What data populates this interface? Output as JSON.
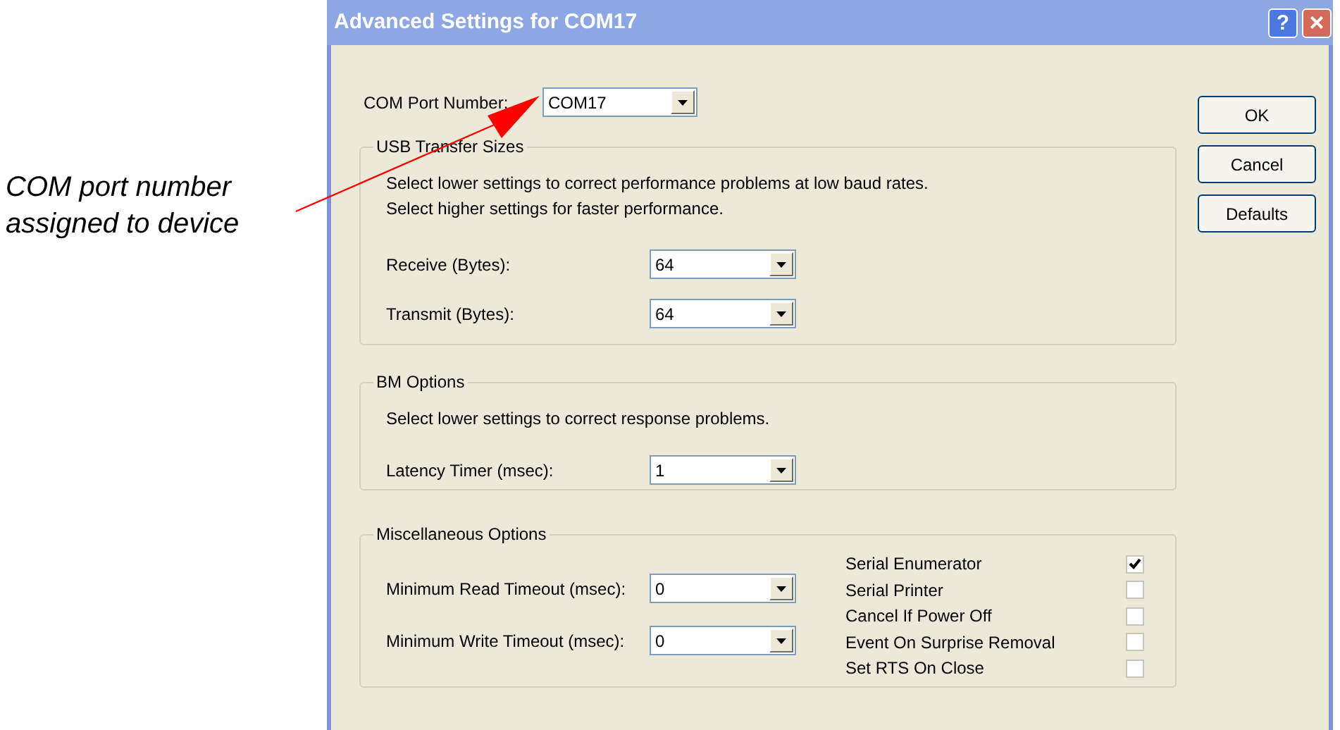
{
  "annotation": {
    "text": "COM port number assigned to device"
  },
  "window": {
    "title": "Advanced Settings for COM17",
    "help": "?",
    "close": "×"
  },
  "com_port": {
    "label": "COM Port Number:",
    "value": "COM17"
  },
  "usb_transfer_sizes": {
    "title": "USB Transfer Sizes",
    "notes": [
      "Select lower settings to correct performance problems at low baud rates.",
      "Select higher settings for faster performance."
    ],
    "fields": [
      {
        "label": "Receive (Bytes):",
        "value": "64"
      },
      {
        "label": "Transmit (Bytes):",
        "value": "64"
      }
    ]
  },
  "bm_options": {
    "title": "BM Options",
    "note": "Select lower settings to correct response problems.",
    "fields": [
      {
        "label": "Latency Timer (msec):",
        "value": "1"
      }
    ]
  },
  "misc_options": {
    "title": "Miscellaneous Options",
    "fields": [
      {
        "label": "Minimum Read Timeout (msec):",
        "value": "0"
      },
      {
        "label": "Minimum Write Timeout (msec):",
        "value": "0"
      }
    ],
    "checkboxes": [
      {
        "label": "Serial Enumerator",
        "checked": true
      },
      {
        "label": "Serial Printer",
        "checked": false
      },
      {
        "label": "Cancel If Power Off",
        "checked": false
      },
      {
        "label": "Event On Surprise Removal",
        "checked": false
      },
      {
        "label": "Set RTS On Close",
        "checked": false
      }
    ]
  },
  "buttons": [
    "OK",
    "Cancel",
    "Defaults"
  ]
}
